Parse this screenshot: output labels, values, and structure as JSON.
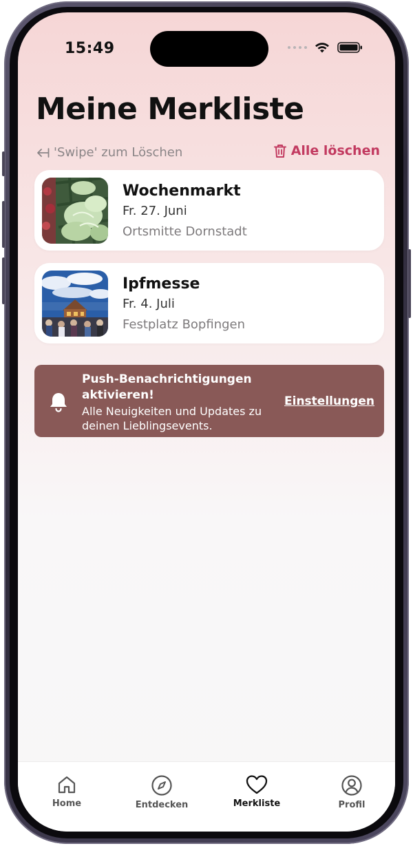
{
  "status_bar": {
    "time": "15:49"
  },
  "header": {
    "title": "Meine Merkliste"
  },
  "actions": {
    "swipe_hint": "'Swipe' zum Löschen",
    "delete_all": "Alle löschen"
  },
  "items": [
    {
      "title": "Wochenmarkt",
      "date": "Fr. 27. Juni",
      "location": "Ortsmitte Dornstadt"
    },
    {
      "title": "Ipfmesse",
      "date": "Fr. 4. Juli",
      "location": "Festplatz Bopfingen"
    }
  ],
  "notification_banner": {
    "title": "Push-Benachrichtigungen aktivieren!",
    "text": "Alle Neuigkeiten und Updates zu deinen Lieblingsevents.",
    "link": "Einstellungen"
  },
  "tabbar": {
    "tabs": [
      {
        "label": "Home",
        "icon": "home-icon"
      },
      {
        "label": "Entdecken",
        "icon": "compass-icon"
      },
      {
        "label": "Merkliste",
        "icon": "heart-icon"
      },
      {
        "label": "Profil",
        "icon": "profile-icon"
      }
    ],
    "active": "Merkliste"
  },
  "colors": {
    "accent": "#c23a60",
    "banner": "#895957"
  }
}
